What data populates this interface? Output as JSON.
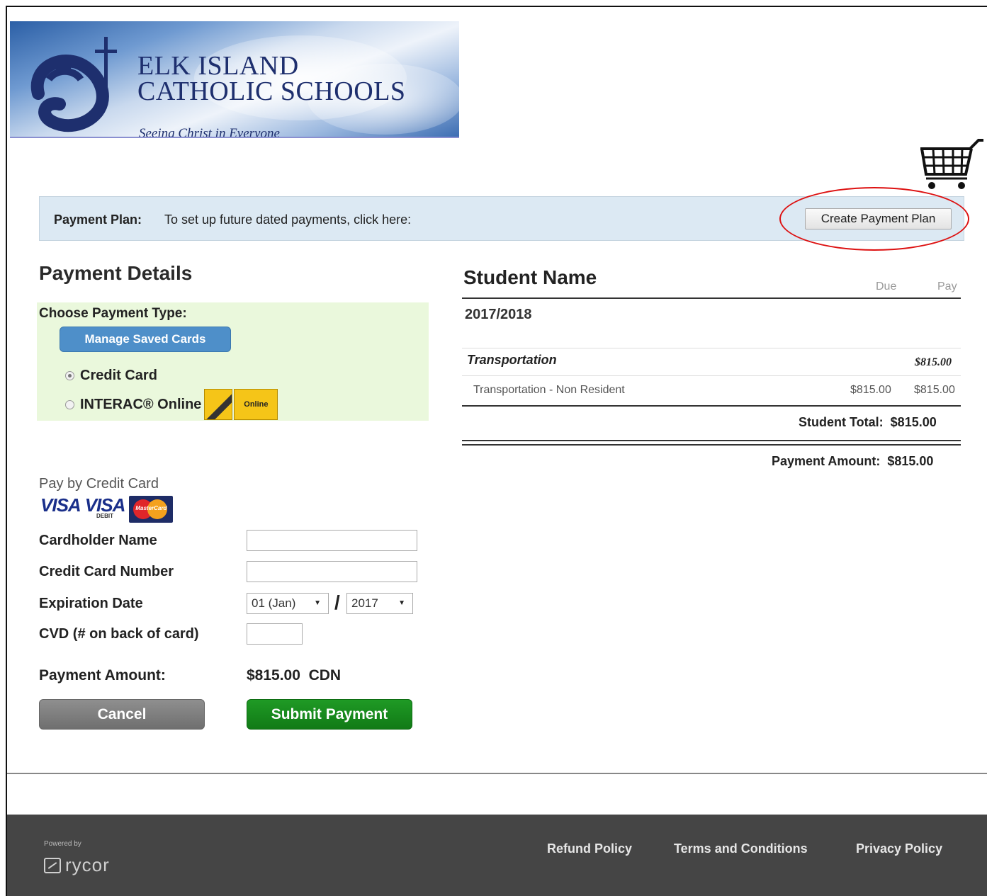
{
  "header": {
    "school_line1": "ELK ISLAND",
    "school_line2": "CATHOLIC SCHOOLS",
    "tagline": "Seeing Christ in Everyone",
    "cart_icon": "shopping-cart-icon"
  },
  "payment_plan": {
    "label": "Payment Plan:",
    "text": "To set up future dated payments, click here:",
    "button_label": "Create Payment Plan"
  },
  "payment_details": {
    "title": "Payment Details",
    "choose_type_label": "Choose Payment Type:",
    "manage_cards_label": "Manage Saved Cards",
    "options": [
      {
        "label": "Credit Card",
        "selected": true
      },
      {
        "label": "INTERAC® Online",
        "selected": false
      }
    ],
    "interac_badge_text": "Online"
  },
  "credit_card_form": {
    "section_label": "Pay by Credit Card",
    "card_brands": {
      "visa": "VISA",
      "visa_debit": "VISA",
      "visa_debit_sub": "DEBIT",
      "mastercard": "MasterCard"
    },
    "cardholder_label": "Cardholder Name",
    "cardholder_value": "",
    "card_number_label": "Credit Card Number",
    "card_number_value": "",
    "expiration_label": "Expiration Date",
    "exp_month": "01 (Jan)",
    "exp_separator": "/",
    "exp_year": "2017",
    "cvd_label": "CVD (# on back of card)",
    "cvd_value": "",
    "amount_label": "Payment Amount:",
    "amount_value": "$815.00",
    "currency": "CDN",
    "cancel_label": "Cancel",
    "submit_label": "Submit Payment"
  },
  "summary": {
    "student_name": "Student Name",
    "col_due": "Due",
    "col_pay": "Pay",
    "year": "2017/2018",
    "category": "Transportation",
    "category_amount": "$815.00",
    "item_label": "Transportation - Non Resident",
    "item_due": "$815.00",
    "item_pay": "$815.00",
    "student_total_label": "Student Total:",
    "student_total_value": "$815.00",
    "payment_amount_label": "Payment Amount:",
    "payment_amount_value": "$815.00"
  },
  "footer": {
    "powered_by": "Powered by",
    "brand": "rycor",
    "links": [
      "Refund Policy",
      "Terms and Conditions",
      "Privacy Policy"
    ]
  },
  "colors": {
    "plan_bar_bg": "#dce9f3",
    "choose_box_bg": "#eaf8dc",
    "manage_button": "#4e8fc9",
    "submit_button": "#1f9a25",
    "cancel_button": "#7f7f7f",
    "footer_bg": "#454545",
    "highlight_ellipse": "#dd1111"
  }
}
